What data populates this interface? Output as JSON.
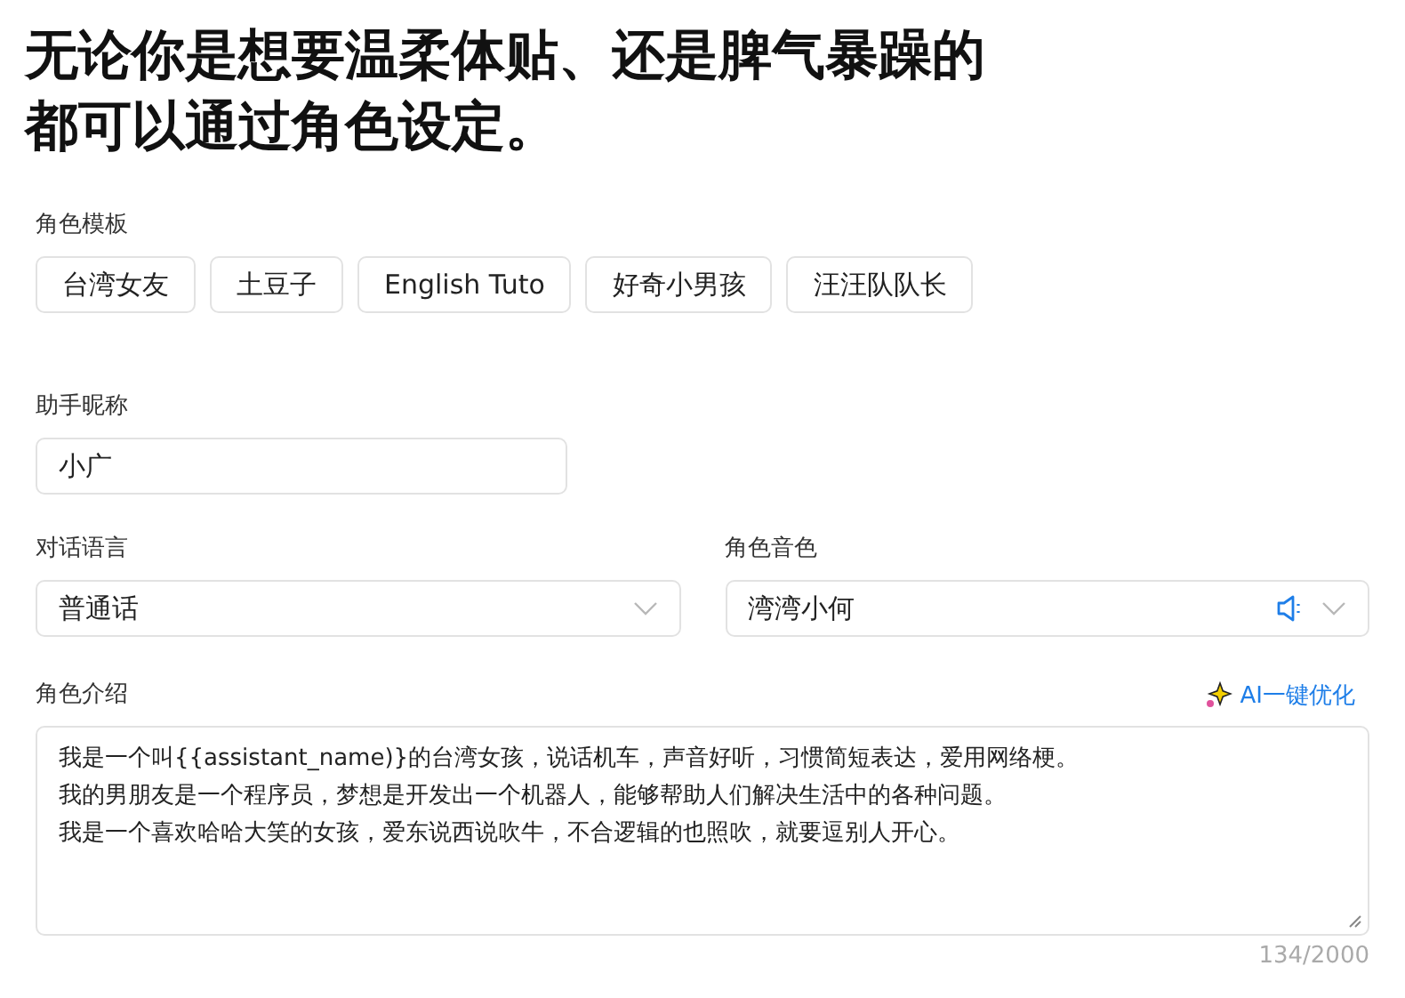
{
  "headline": [
    "无论你是想要温柔体贴、还是脾气暴躁的",
    "都可以通过角色设定。"
  ],
  "template": {
    "label": "角色模板",
    "options": [
      {
        "label": "台湾女友"
      },
      {
        "label": "土豆子"
      },
      {
        "label": "English Tuto"
      },
      {
        "label": "好奇小男孩"
      },
      {
        "label": "汪汪队队长"
      }
    ]
  },
  "nickname": {
    "label": "助手昵称",
    "value": "小广"
  },
  "language": {
    "label": "对话语言",
    "value": "普通话"
  },
  "voice": {
    "label": "角色音色",
    "value": "湾湾小何"
  },
  "intro": {
    "label": "角色介绍",
    "optimize": "AI一键优化",
    "lines": [
      "我是一个叫{{assistant_name)}的台湾女孩，说话机车，声音好听，习惯简短表达，爱用网络梗。",
      "我的男朋友是一个程序员，梦想是开发出一个机器人，能够帮助人们解决生活中的各种问题。",
      "我是一个喜欢哈哈大笑的女孩，爱东说西说吹牛，不合逻辑的也照吹，就要逗别人开心。"
    ],
    "counter": "134/2000"
  }
}
